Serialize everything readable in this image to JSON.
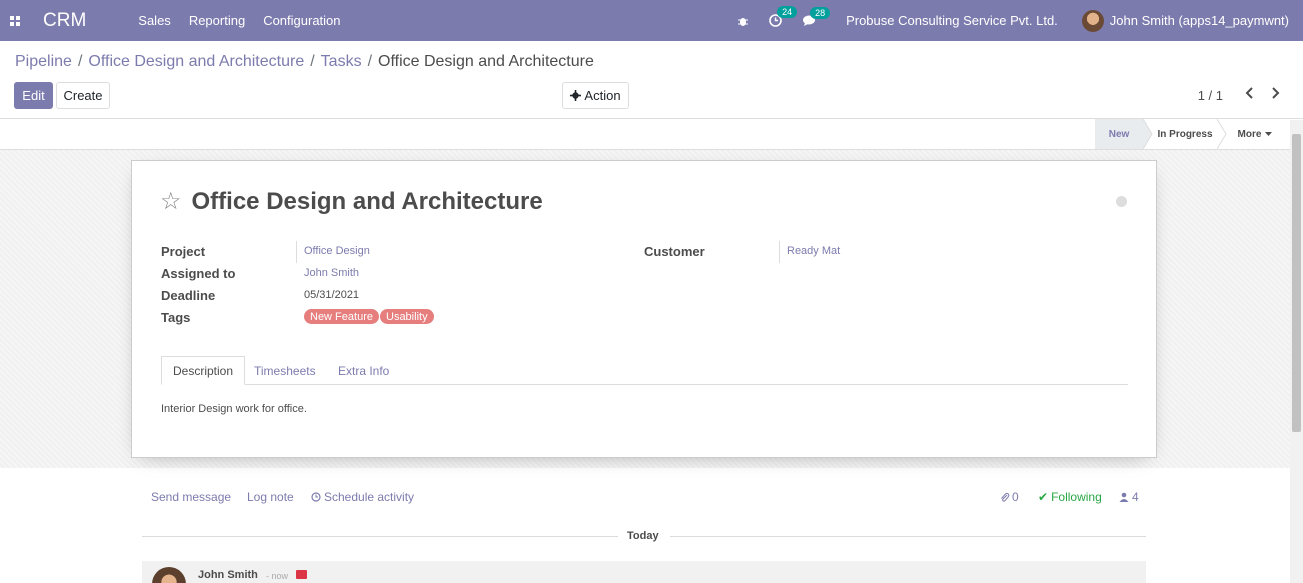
{
  "navbar": {
    "brand": "CRM",
    "menus": [
      "Sales",
      "Reporting",
      "Configuration"
    ],
    "activity_count": "24",
    "message_count": "28",
    "company": "Probuse Consulting Service Pvt. Ltd.",
    "user": "John Smith (apps14_paymwnt)"
  },
  "breadcrumb": [
    "Pipeline",
    "Office Design and Architecture",
    "Tasks",
    "Office Design and Architecture"
  ],
  "buttons": {
    "edit": "Edit",
    "create": "Create",
    "action": "Action"
  },
  "pager": {
    "value": "1 / 1"
  },
  "stages": {
    "new": "New",
    "in_progress": "In Progress",
    "more": "More"
  },
  "task": {
    "title": "Office Design and Architecture",
    "labels": {
      "project": "Project",
      "assigned_to": "Assigned to",
      "deadline": "Deadline",
      "tags": "Tags",
      "customer": "Customer"
    },
    "project": "Office Design",
    "assigned_to": "John Smith",
    "deadline": "05/31/2021",
    "tags": [
      "New Feature",
      "Usability"
    ],
    "customer": "Ready Mat"
  },
  "tabs": [
    "Description",
    "Timesheets",
    "Extra Info"
  ],
  "description": "Interior Design work for office.",
  "chatter": {
    "send_message": "Send message",
    "log_note": "Log note",
    "schedule_activity": "Schedule activity",
    "attachments": "0",
    "following": "Following",
    "followers": "4",
    "today": "Today",
    "message_author": "John Smith",
    "message_date": "- now"
  },
  "colors": {
    "brand": "#7c7bad",
    "tag": "#e67e7e",
    "following": "#28a745"
  }
}
